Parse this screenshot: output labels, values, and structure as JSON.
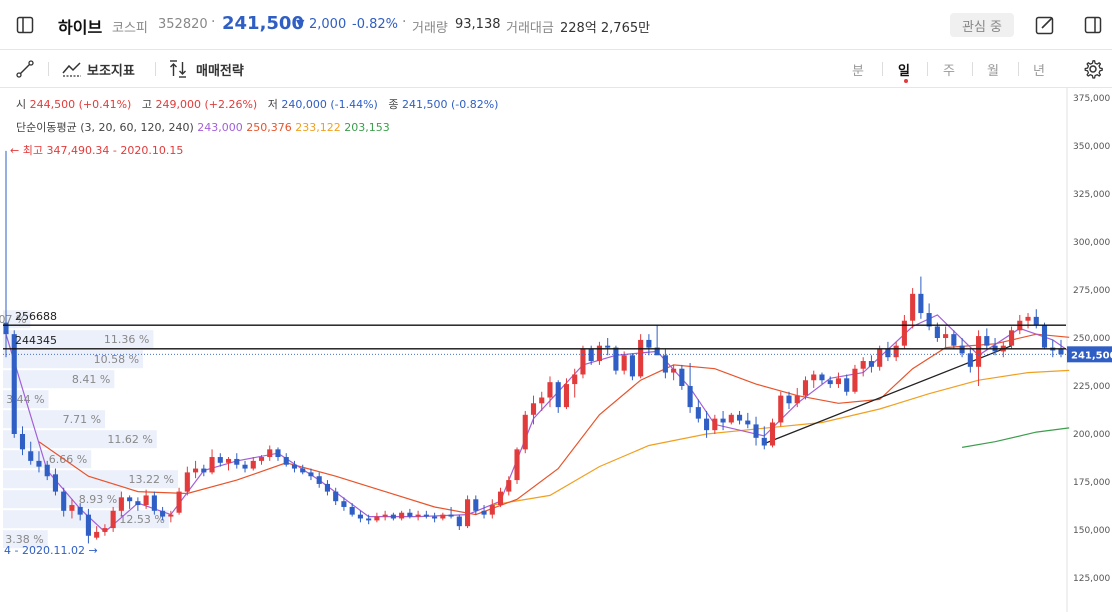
{
  "header": {
    "stock_name": "하이브",
    "market": "코스피",
    "code": "352820",
    "separator": "·",
    "price": "241,500",
    "change_arrow": "▼",
    "change": "2,000",
    "change_pct": "-0.82%",
    "volume_label": "거래량",
    "volume_value": "93,138",
    "amount_label": "거래대금",
    "amount_value": "228억 2,765만",
    "watch_label": "관심 중"
  },
  "toolbar": {
    "indicator_label": "보조지표",
    "strategy_label": "매매전략",
    "periods": [
      "분",
      "일",
      "주",
      "월",
      "년"
    ],
    "active_period": "일"
  },
  "info": {
    "open_label": "시",
    "open_value": "244,500 (+0.41%)",
    "high_label": "고",
    "high_value": "249,000 (+2.26%)",
    "low_label": "저",
    "low_value": "240,000 (-1.44%)",
    "close_label": "종",
    "close_value": "241,500 (-0.82%)",
    "ma_label": "단순이동평균 (3, 20, 60, 120, 240)",
    "ma_values": [
      "243,000",
      "250,376",
      "233,122",
      "203,153"
    ],
    "high_note": "← 최고 347,490.34 - 2020.10.15",
    "low_note": "4 - 2020.11.02 →"
  },
  "colors": {
    "up": "#e23b3b",
    "down": "#2f5ec4",
    "ma3": "#a35fd8",
    "ma20": "#e8542b",
    "ma60": "#f0a020",
    "ma120": "#3c9e4c"
  },
  "chart_data": {
    "type": "candlestick",
    "y_ticks": [
      "375,000",
      "350,000",
      "325,000",
      "300,000",
      "275,000",
      "250,000",
      "225,000",
      "200,000",
      "175,000",
      "150,000",
      "125,000"
    ],
    "ylim": [
      118000,
      378000
    ],
    "current_price_label": "241,500",
    "current_price": 241500,
    "h_lines": [
      {
        "label": "256688",
        "value": 256688
      },
      {
        "label": "244345",
        "value": 244345
      }
    ],
    "volume_profile": [
      "2.07 %",
      "11.36 %",
      "10.58 %",
      "8.41 %",
      "3.44 %",
      "7.71 %",
      "11.62 %",
      "6.66 %",
      "13.22 %",
      "8.93 %",
      "12.53 %",
      "3.38 %"
    ],
    "volume_profile_values": [
      2.07,
      11.36,
      10.58,
      8.41,
      3.44,
      7.71,
      11.62,
      6.66,
      13.22,
      8.93,
      12.53,
      3.38
    ],
    "candles": [
      [
        258000,
        347490,
        240000,
        252000
      ],
      [
        252000,
        254000,
        198000,
        200000
      ],
      [
        200000,
        204000,
        189000,
        192000
      ],
      [
        191000,
        196000,
        184000,
        186000
      ],
      [
        186000,
        191000,
        180000,
        183000
      ],
      [
        184000,
        186000,
        176000,
        178000
      ],
      [
        179000,
        182000,
        168000,
        170000
      ],
      [
        170000,
        172000,
        157000,
        160000
      ],
      [
        160000,
        166000,
        156000,
        163000
      ],
      [
        162000,
        164000,
        155000,
        158000
      ],
      [
        158000,
        161000,
        143000,
        147000
      ],
      [
        146000,
        152000,
        145000,
        149000
      ],
      [
        149000,
        153000,
        147000,
        151000
      ],
      [
        151000,
        162000,
        149000,
        160000
      ],
      [
        160000,
        170000,
        157000,
        167000
      ],
      [
        167000,
        168000,
        161000,
        165000
      ],
      [
        165000,
        167000,
        160000,
        163000
      ],
      [
        163000,
        171000,
        161000,
        168000
      ],
      [
        168000,
        170000,
        158000,
        160000
      ],
      [
        160000,
        162000,
        155000,
        157000
      ],
      [
        157000,
        160000,
        154000,
        158000
      ],
      [
        159000,
        172000,
        158000,
        170000
      ],
      [
        170000,
        183000,
        168000,
        180000
      ],
      [
        180000,
        186000,
        177000,
        182000
      ],
      [
        182000,
        184000,
        178000,
        180000
      ],
      [
        180000,
        192000,
        179000,
        188000
      ],
      [
        188000,
        190000,
        183000,
        185000
      ],
      [
        185000,
        188000,
        181000,
        187000
      ],
      [
        187000,
        190000,
        182000,
        184000
      ],
      [
        184000,
        186000,
        180000,
        182000
      ],
      [
        182000,
        188000,
        181000,
        186000
      ],
      [
        186000,
        189000,
        184000,
        188000
      ],
      [
        188000,
        194000,
        186000,
        192000
      ],
      [
        192000,
        193000,
        186000,
        188000
      ],
      [
        188000,
        190000,
        183000,
        184000
      ],
      [
        184000,
        186000,
        180000,
        182000
      ],
      [
        182000,
        184000,
        179000,
        180000
      ],
      [
        180000,
        182000,
        176000,
        178000
      ],
      [
        178000,
        180000,
        172000,
        174000
      ],
      [
        174000,
        176000,
        168000,
        170000
      ],
      [
        170000,
        172000,
        163000,
        165000
      ],
      [
        165000,
        167000,
        160000,
        162000
      ],
      [
        162000,
        164000,
        157000,
        158000
      ],
      [
        158000,
        160000,
        154000,
        156000
      ],
      [
        156000,
        158000,
        153000,
        155000
      ],
      [
        155000,
        159000,
        154000,
        157000
      ],
      [
        157000,
        160000,
        155000,
        158000
      ],
      [
        158000,
        159000,
        155000,
        156000
      ],
      [
        156000,
        160000,
        155000,
        159000
      ],
      [
        159000,
        161000,
        156000,
        157000
      ],
      [
        157000,
        160000,
        155000,
        158000
      ],
      [
        158000,
        160000,
        156000,
        157000
      ],
      [
        157000,
        159000,
        154000,
        156000
      ],
      [
        156000,
        159000,
        155000,
        158000
      ],
      [
        158000,
        162000,
        156000,
        157000
      ],
      [
        157000,
        158000,
        150000,
        152000
      ],
      [
        152000,
        168000,
        151000,
        166000
      ],
      [
        166000,
        168000,
        158000,
        160000
      ],
      [
        160000,
        163000,
        156000,
        158000
      ],
      [
        158000,
        166000,
        156000,
        163000
      ],
      [
        163000,
        172000,
        162000,
        170000
      ],
      [
        170000,
        178000,
        168000,
        176000
      ],
      [
        176000,
        193000,
        174000,
        192000
      ],
      [
        192000,
        212000,
        190000,
        210000
      ],
      [
        210000,
        220000,
        205000,
        216000
      ],
      [
        216000,
        222000,
        212000,
        219000
      ],
      [
        219000,
        230000,
        214000,
        227000
      ],
      [
        227000,
        228000,
        211000,
        214000
      ],
      [
        214000,
        229000,
        213000,
        226000
      ],
      [
        226000,
        234000,
        219000,
        231000
      ],
      [
        231000,
        246000,
        229000,
        244000
      ],
      [
        244000,
        246000,
        236000,
        238000
      ],
      [
        238000,
        248000,
        236000,
        246000
      ],
      [
        246000,
        250000,
        241000,
        245000
      ],
      [
        245000,
        246000,
        231000,
        233000
      ],
      [
        233000,
        243000,
        231000,
        241000
      ],
      [
        241000,
        242000,
        228000,
        230000
      ],
      [
        230000,
        252000,
        229000,
        249000
      ],
      [
        249000,
        252000,
        241000,
        245000
      ],
      [
        245000,
        257000,
        243000,
        241000
      ],
      [
        241000,
        244000,
        229000,
        232000
      ],
      [
        232000,
        236000,
        228000,
        234000
      ],
      [
        234000,
        236000,
        223000,
        225000
      ],
      [
        225000,
        237000,
        211000,
        214000
      ],
      [
        214000,
        218000,
        206000,
        208000
      ],
      [
        208000,
        212000,
        198000,
        202000
      ],
      [
        202000,
        210000,
        200000,
        208000
      ],
      [
        208000,
        212000,
        202000,
        206000
      ],
      [
        206000,
        211000,
        205000,
        210000
      ],
      [
        210000,
        212000,
        205000,
        207000
      ],
      [
        207000,
        211000,
        203000,
        205000
      ],
      [
        205000,
        209000,
        194000,
        198000
      ],
      [
        198000,
        204000,
        192000,
        194000
      ],
      [
        194000,
        208000,
        193000,
        206000
      ],
      [
        206000,
        222000,
        204000,
        220000
      ],
      [
        220000,
        222000,
        213000,
        216000
      ],
      [
        216000,
        224000,
        214000,
        220000
      ],
      [
        220000,
        230000,
        218000,
        228000
      ],
      [
        228000,
        233000,
        224000,
        231000
      ],
      [
        231000,
        232000,
        226000,
        228000
      ],
      [
        228000,
        230000,
        224000,
        226000
      ],
      [
        226000,
        232000,
        224000,
        229000
      ],
      [
        229000,
        231000,
        220000,
        222000
      ],
      [
        222000,
        236000,
        221000,
        234000
      ],
      [
        234000,
        240000,
        230000,
        238000
      ],
      [
        238000,
        241000,
        232000,
        235000
      ],
      [
        235000,
        246000,
        233000,
        244000
      ],
      [
        244000,
        248000,
        238000,
        240000
      ],
      [
        240000,
        248000,
        238000,
        246000
      ],
      [
        246000,
        262000,
        244000,
        259000
      ],
      [
        259000,
        276000,
        255000,
        273000
      ],
      [
        273000,
        282000,
        260000,
        263000
      ],
      [
        263000,
        268000,
        254000,
        256000
      ],
      [
        256000,
        258000,
        248000,
        250000
      ],
      [
        250000,
        256000,
        245000,
        252000
      ],
      [
        252000,
        254000,
        244000,
        246000
      ],
      [
        246000,
        250000,
        240000,
        242000
      ],
      [
        242000,
        244000,
        232000,
        235000
      ],
      [
        235000,
        254000,
        225000,
        251000
      ],
      [
        251000,
        255000,
        244000,
        246000
      ],
      [
        246000,
        250000,
        241000,
        243000
      ],
      [
        243000,
        248000,
        240000,
        246000
      ],
      [
        246000,
        256000,
        244000,
        254000
      ],
      [
        254000,
        262000,
        252000,
        259000
      ],
      [
        259000,
        263000,
        255000,
        261000
      ],
      [
        261000,
        265000,
        255000,
        257000
      ],
      [
        257000,
        258000,
        244000,
        245000
      ],
      [
        245000,
        249000,
        240000,
        243500
      ],
      [
        244500,
        249000,
        240000,
        241500
      ]
    ],
    "ma3": [
      [
        0,
        252000
      ],
      [
        5,
        181000
      ],
      [
        9,
        161000
      ],
      [
        12,
        149000
      ],
      [
        16,
        164000
      ],
      [
        20,
        158000
      ],
      [
        24,
        181000
      ],
      [
        28,
        186000
      ],
      [
        33,
        190000
      ],
      [
        38,
        176000
      ],
      [
        44,
        157000
      ],
      [
        50,
        157000
      ],
      [
        56,
        158000
      ],
      [
        60,
        165000
      ],
      [
        64,
        208000
      ],
      [
        70,
        236000
      ],
      [
        74,
        241000
      ],
      [
        79,
        243000
      ],
      [
        83,
        224000
      ],
      [
        86,
        205000
      ],
      [
        92,
        199000
      ],
      [
        96,
        216000
      ],
      [
        100,
        229000
      ],
      [
        104,
        232000
      ],
      [
        110,
        256000
      ],
      [
        113,
        262000
      ],
      [
        118,
        241000
      ],
      [
        123,
        255000
      ],
      [
        127,
        249000
      ],
      [
        129,
        243000
      ]
    ],
    "ma20": [
      [
        4,
        196000
      ],
      [
        10,
        178000
      ],
      [
        16,
        170000
      ],
      [
        22,
        169000
      ],
      [
        28,
        176000
      ],
      [
        34,
        185000
      ],
      [
        40,
        178000
      ],
      [
        46,
        170000
      ],
      [
        52,
        162000
      ],
      [
        57,
        158000
      ],
      [
        62,
        166000
      ],
      [
        67,
        182000
      ],
      [
        72,
        210000
      ],
      [
        77,
        228000
      ],
      [
        81,
        236000
      ],
      [
        86,
        234000
      ],
      [
        91,
        226000
      ],
      [
        96,
        220000
      ],
      [
        101,
        216000
      ],
      [
        106,
        218000
      ],
      [
        110,
        234000
      ],
      [
        114,
        245000
      ],
      [
        120,
        247000
      ],
      [
        125,
        252000
      ],
      [
        129,
        250376
      ]
    ],
    "ma60": [
      [
        59,
        163000
      ],
      [
        66,
        168000
      ],
      [
        72,
        183000
      ],
      [
        78,
        194000
      ],
      [
        85,
        200000
      ],
      [
        92,
        203000
      ],
      [
        99,
        206000
      ],
      [
        106,
        213000
      ],
      [
        112,
        221000
      ],
      [
        118,
        228000
      ],
      [
        124,
        232000
      ],
      [
        129,
        233122
      ]
    ],
    "ma120": [
      [
        116,
        193000
      ],
      [
        120,
        196000
      ],
      [
        125,
        201000
      ],
      [
        129,
        203153
      ]
    ],
    "trendline": [
      [
        92,
        195000
      ],
      [
        122,
        246000
      ]
    ]
  }
}
